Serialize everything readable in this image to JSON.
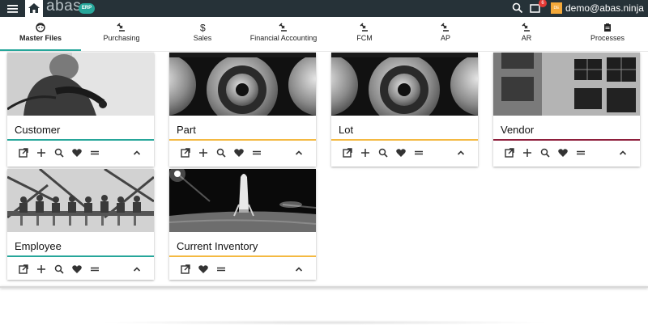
{
  "app": {
    "logo_text": "abas",
    "logo_badge": "ERP",
    "user_email": "demo@abas.ninja",
    "avatar_initials": "DE",
    "notification_count": "6"
  },
  "tabs": [
    {
      "label": "Master Files",
      "icon": "face-icon",
      "active": true
    },
    {
      "label": "Purchasing",
      "icon": "gavel-icon"
    },
    {
      "label": "Sales",
      "icon": "dollar-icon"
    },
    {
      "label": "Financial Accounting",
      "icon": "gavel-icon"
    },
    {
      "label": "FCM",
      "icon": "gavel-icon"
    },
    {
      "label": "AP",
      "icon": "gavel-icon"
    },
    {
      "label": "AR",
      "icon": "gavel-icon"
    },
    {
      "label": "Processes",
      "icon": "clipboard-icon"
    }
  ],
  "cards": [
    {
      "title": "Customer",
      "accent": "#26a69a",
      "image": "photo-person-riding",
      "actions": [
        "open-in-new-icon",
        "add-icon",
        "search-icon",
        "heart-icon",
        "menu-icon"
      ]
    },
    {
      "title": "Part",
      "accent": "#f4b942",
      "image": "photo-gears",
      "actions": [
        "open-in-new-icon",
        "add-icon",
        "search-icon",
        "heart-icon",
        "menu-icon"
      ]
    },
    {
      "title": "Lot",
      "accent": "#f4b942",
      "image": "photo-gears",
      "actions": [
        "open-in-new-icon",
        "add-icon",
        "search-icon",
        "heart-icon",
        "menu-icon"
      ]
    },
    {
      "title": "Vendor",
      "accent": "#8e1f3c",
      "image": "photo-brick-building",
      "actions": [
        "open-in-new-icon",
        "add-icon",
        "search-icon",
        "heart-icon",
        "menu-icon"
      ]
    },
    {
      "title": "Employee",
      "accent": "#26a69a",
      "image": "photo-workers-on-beam",
      "actions": [
        "open-in-new-icon",
        "add-icon",
        "search-icon",
        "heart-icon",
        "menu-icon"
      ]
    },
    {
      "title": "Current Inventory",
      "accent": "#f4b942",
      "image": "photo-rocket-on-moon",
      "actions": [
        "open-in-new-icon",
        "heart-icon",
        "menu-icon"
      ]
    }
  ]
}
